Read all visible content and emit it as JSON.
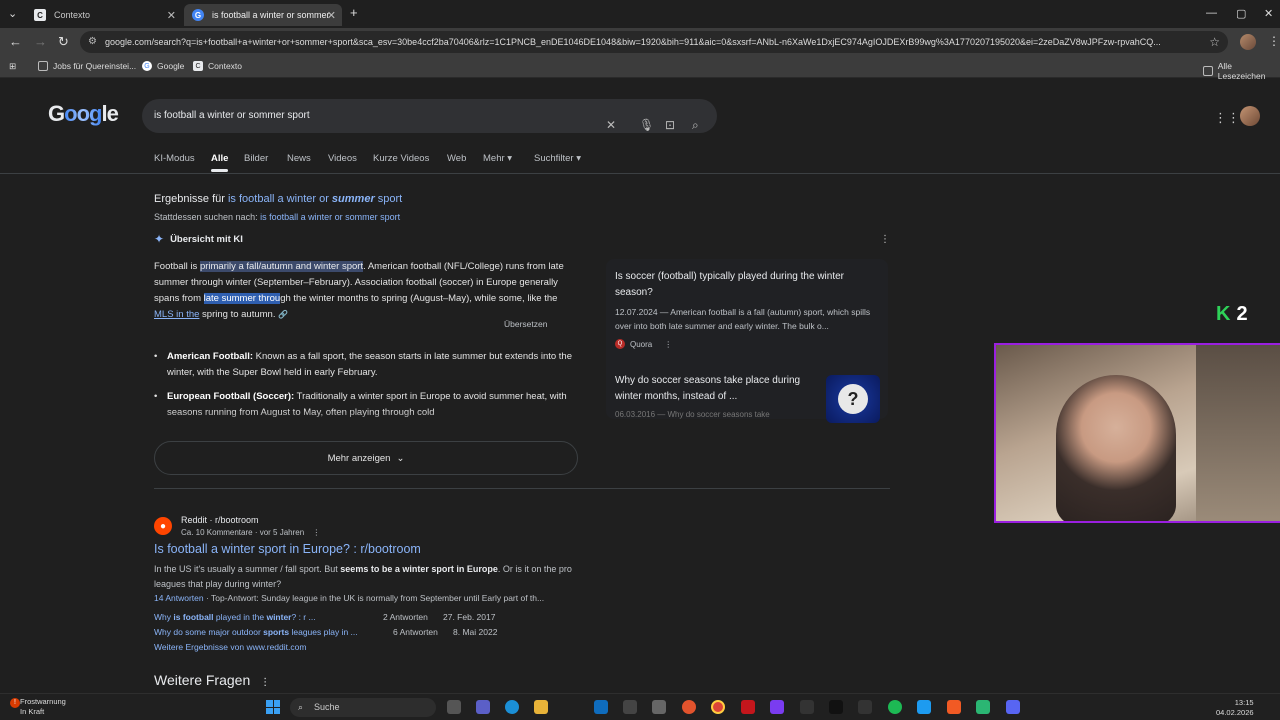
{
  "browser": {
    "tabs": [
      {
        "title": "Contexto",
        "icon": "C"
      },
      {
        "title": "is football a winter or sommer spo",
        "icon": "G"
      }
    ],
    "new_tab_glyph": "+",
    "url": "google.com/search?q=is+football+a+winter+or+sommer+sport&sca_esv=30be4ccf2ba70406&rlz=1C1PNCB_enDE1046DE1048&biw=1920&bih=911&aic=0&sxsrf=ANbL-n6XaWe1DxjEC974AgIOJDEXrB99wg%3A1770207195020&ei=2zeDaZV8wJPFzw-rpvahCQ...",
    "bookmarks": [
      {
        "label": "Jobs für Quereinstei...",
        "icon": "folder-icon"
      },
      {
        "label": "Google",
        "icon": "G"
      },
      {
        "label": "Contexto",
        "icon": "C"
      }
    ],
    "all_bookmarks": "Alle Lesezeichen"
  },
  "google": {
    "logo": {
      "left": "G",
      "middle": "oog",
      "right": "le"
    },
    "query": "is football a winter or sommer sport",
    "tabs": [
      "KI-Modus",
      "Alle",
      "Bilder",
      "News",
      "Videos",
      "Kurze Videos",
      "Web",
      "Mehr ▾",
      "Suchfilter ▾"
    ],
    "spell": {
      "prefix": "Ergebnisse für ",
      "corrected_a": "is football a winter or ",
      "corrected_b": "summer",
      "corrected_c": " sport",
      "instead_prefix": "Stattdessen suchen nach: ",
      "instead_link": "is football a winter or sommer sport"
    },
    "ai": {
      "heading": "Übersicht mit KI",
      "p1_a": "Football is ",
      "p1_hl": "primarily a fall/autumn and winter sport",
      "p1_b": ". American football (NFL/College) runs from late summer through winter (September–February). Association football (soccer) in Europe generally spans from ",
      "p1_sel": "late summer throu",
      "p1_c": "gh the winter months to spring (August–May), while some, like the ",
      "p1_link": "MLS in the",
      "p1_d": " spring to autumn.",
      "tooltip": "Übersetzen",
      "bullet1_bold": "American Football:",
      "bullet1_text": " Known as a fall sport, the season starts in late summer but extends into the winter, with the Super Bowl held in early February.",
      "bullet2_bold": "European Football (Soccer):",
      "bullet2_text": " Traditionally a winter sport in Europe to avoid summer heat, with seasons running from August to May, often playing through cold",
      "more_button": "Mehr anzeigen"
    },
    "side": {
      "q1_title": "Is soccer (football) typically played during the winter season?",
      "q1_snippet": "12.07.2024 — American football is a fall (autumn) sport, which spills over into both late summer and early winter. The bulk o...",
      "q1_source": "Quora",
      "q2_title": "Why do soccer seasons take place during winter months, instead of ...",
      "q2_date": "06.03.2016 — Why do soccer seasons take"
    },
    "result": {
      "site": "Reddit · r/bootroom",
      "meta": "Ca. 10 Kommentare · vor 5 Jahren",
      "title": "Is football a winter sport in Europe? : r/bootroom",
      "snip_a": "In the US it's usually a summer / fall sport. But ",
      "snip_b": "seems to be a winter sport in Europe",
      "snip_c": ". Or is it on the pro leagues that play during winter?",
      "answers_link": "14 Antworten",
      "answers_text": " · Top-Antwort: Sunday league in the UK is normally from September until Early part of th...",
      "related": [
        {
          "a": "Why ",
          "b": "is football",
          "c": " played in the ",
          "d": "winter",
          "e": "? : r ...",
          "count": "2 Antworten",
          "date": "27. Feb. 2017"
        },
        {
          "a": "Why do some major outdoor ",
          "b": "sports",
          "c": " leagues play in ...",
          "d": "",
          "e": "",
          "count": "6 Antworten",
          "date": "8. Mai 2022"
        }
      ],
      "more_results": "Weitere Ergebnisse von www.reddit.com"
    },
    "more_questions": "Weitere Fragen"
  },
  "overlay": {
    "k_letter": "K",
    "k_number": "2"
  },
  "taskbar": {
    "weather_title": "Frostwarnung",
    "weather_sub": "In Kraft",
    "search": "Suche",
    "time": "13:15",
    "date": "04.02.2026"
  }
}
